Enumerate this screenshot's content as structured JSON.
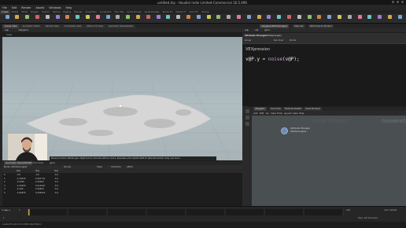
{
  "window": {
    "title": "untitled.hip - Houdini Indie Limited-Commercial 16.5.496"
  },
  "menu": [
    "File",
    "Edit",
    "Render",
    "Assets",
    "Windows",
    "Help"
  ],
  "desktop": "Build",
  "shelf_tabs": [
    "Create",
    "Modify",
    "Model",
    "Polygon",
    "Deform",
    "Texture",
    "Rigging",
    "Muscles",
    "Characters",
    "Constraints",
    "Hair Utils",
    "Guide Process",
    "Guide Brushes",
    "Terrain FX",
    "Simple FX",
    "Cloud FX",
    "Volume"
  ],
  "viewport": {
    "tabs": [
      "Scene View",
      "Animation Editor",
      "Render View",
      "Composite View",
      "Motion FX View",
      "Geometry Spreadsheet"
    ],
    "path": "/obj/geo1",
    "label": "View",
    "hud_text": "Mouse functions. Middle pans. Right zooms. Ctrl+Alt+left box zooms. Spacebar+Ctrl+Alt/Alt+Shift for alternate tumble, dolly, and zoom."
  },
  "right_panel": {
    "tabs": [
      "/obj/geo1/attribwrangle1",
      "Take List",
      "Performance Monitor"
    ],
    "path_label": "obj",
    "path_value": "geo1",
    "node_type": "Attribute Wrangle",
    "node_name": "attribwrangle1",
    "group_label": "Group",
    "group_type_label": "Group Type",
    "group_type": "Guess from Group",
    "run_over_label": "Run Over",
    "run_over": "Points",
    "vex_label": "VEXpression",
    "vex_code_prefix": "v@P.y = ",
    "vex_code_fn": "noise",
    "vex_code_suffix": "(v@P);"
  },
  "network": {
    "tabs": [
      "/obj/geo1",
      "Tree View",
      "Material Palette",
      "Asset Browser"
    ],
    "path": "obj",
    "path2": "geo1",
    "menu": [
      "Add",
      "Edit",
      "Go",
      "View",
      "Tools",
      "Layout",
      "Labs",
      "Help"
    ],
    "bg_label": "Geometry",
    "bg_label2": "Indie Edition",
    "node_type": "Attribute Wrangle",
    "node_name": "attribwrangle1"
  },
  "spreadsheet": {
    "tabs": [
      "Geometry Spreadsheet",
      "Scene View"
    ],
    "path": "geo1",
    "node_label": "Node: attribwrangle1",
    "group_label": "Group:",
    "view_label": "View",
    "intrinsics_label": "Intrinsics",
    "attrib_label": "Attrib",
    "columns": [
      "",
      "P[x]",
      "P[y]",
      "P[z]"
    ],
    "rows": [
      [
        "0",
        "-5.0",
        "-0.5",
        "-5.0"
      ],
      [
        "1",
        "-4.79975",
        "0.497731",
        "-5.0"
      ],
      [
        "2",
        "-4.5995",
        "0.45643",
        "-5.0"
      ],
      [
        "3",
        "-4.39925",
        "0.411067",
        "-5.0"
      ],
      [
        "4",
        "-4.199",
        "0.44625",
        "-5.0"
      ],
      [
        "5",
        "-3.99875",
        "0.495625",
        "-5.0"
      ]
    ]
  },
  "timeline": {
    "frame": "1",
    "start": "1",
    "end": "240",
    "key_label": "Keys, 0/0 Channels",
    "auto_update": "Auto Update"
  },
  "status": "Loaded Houdini 16.5.496 Indie Edition",
  "colors": {
    "accent": "#e0a341",
    "node": "#6b8db8"
  }
}
